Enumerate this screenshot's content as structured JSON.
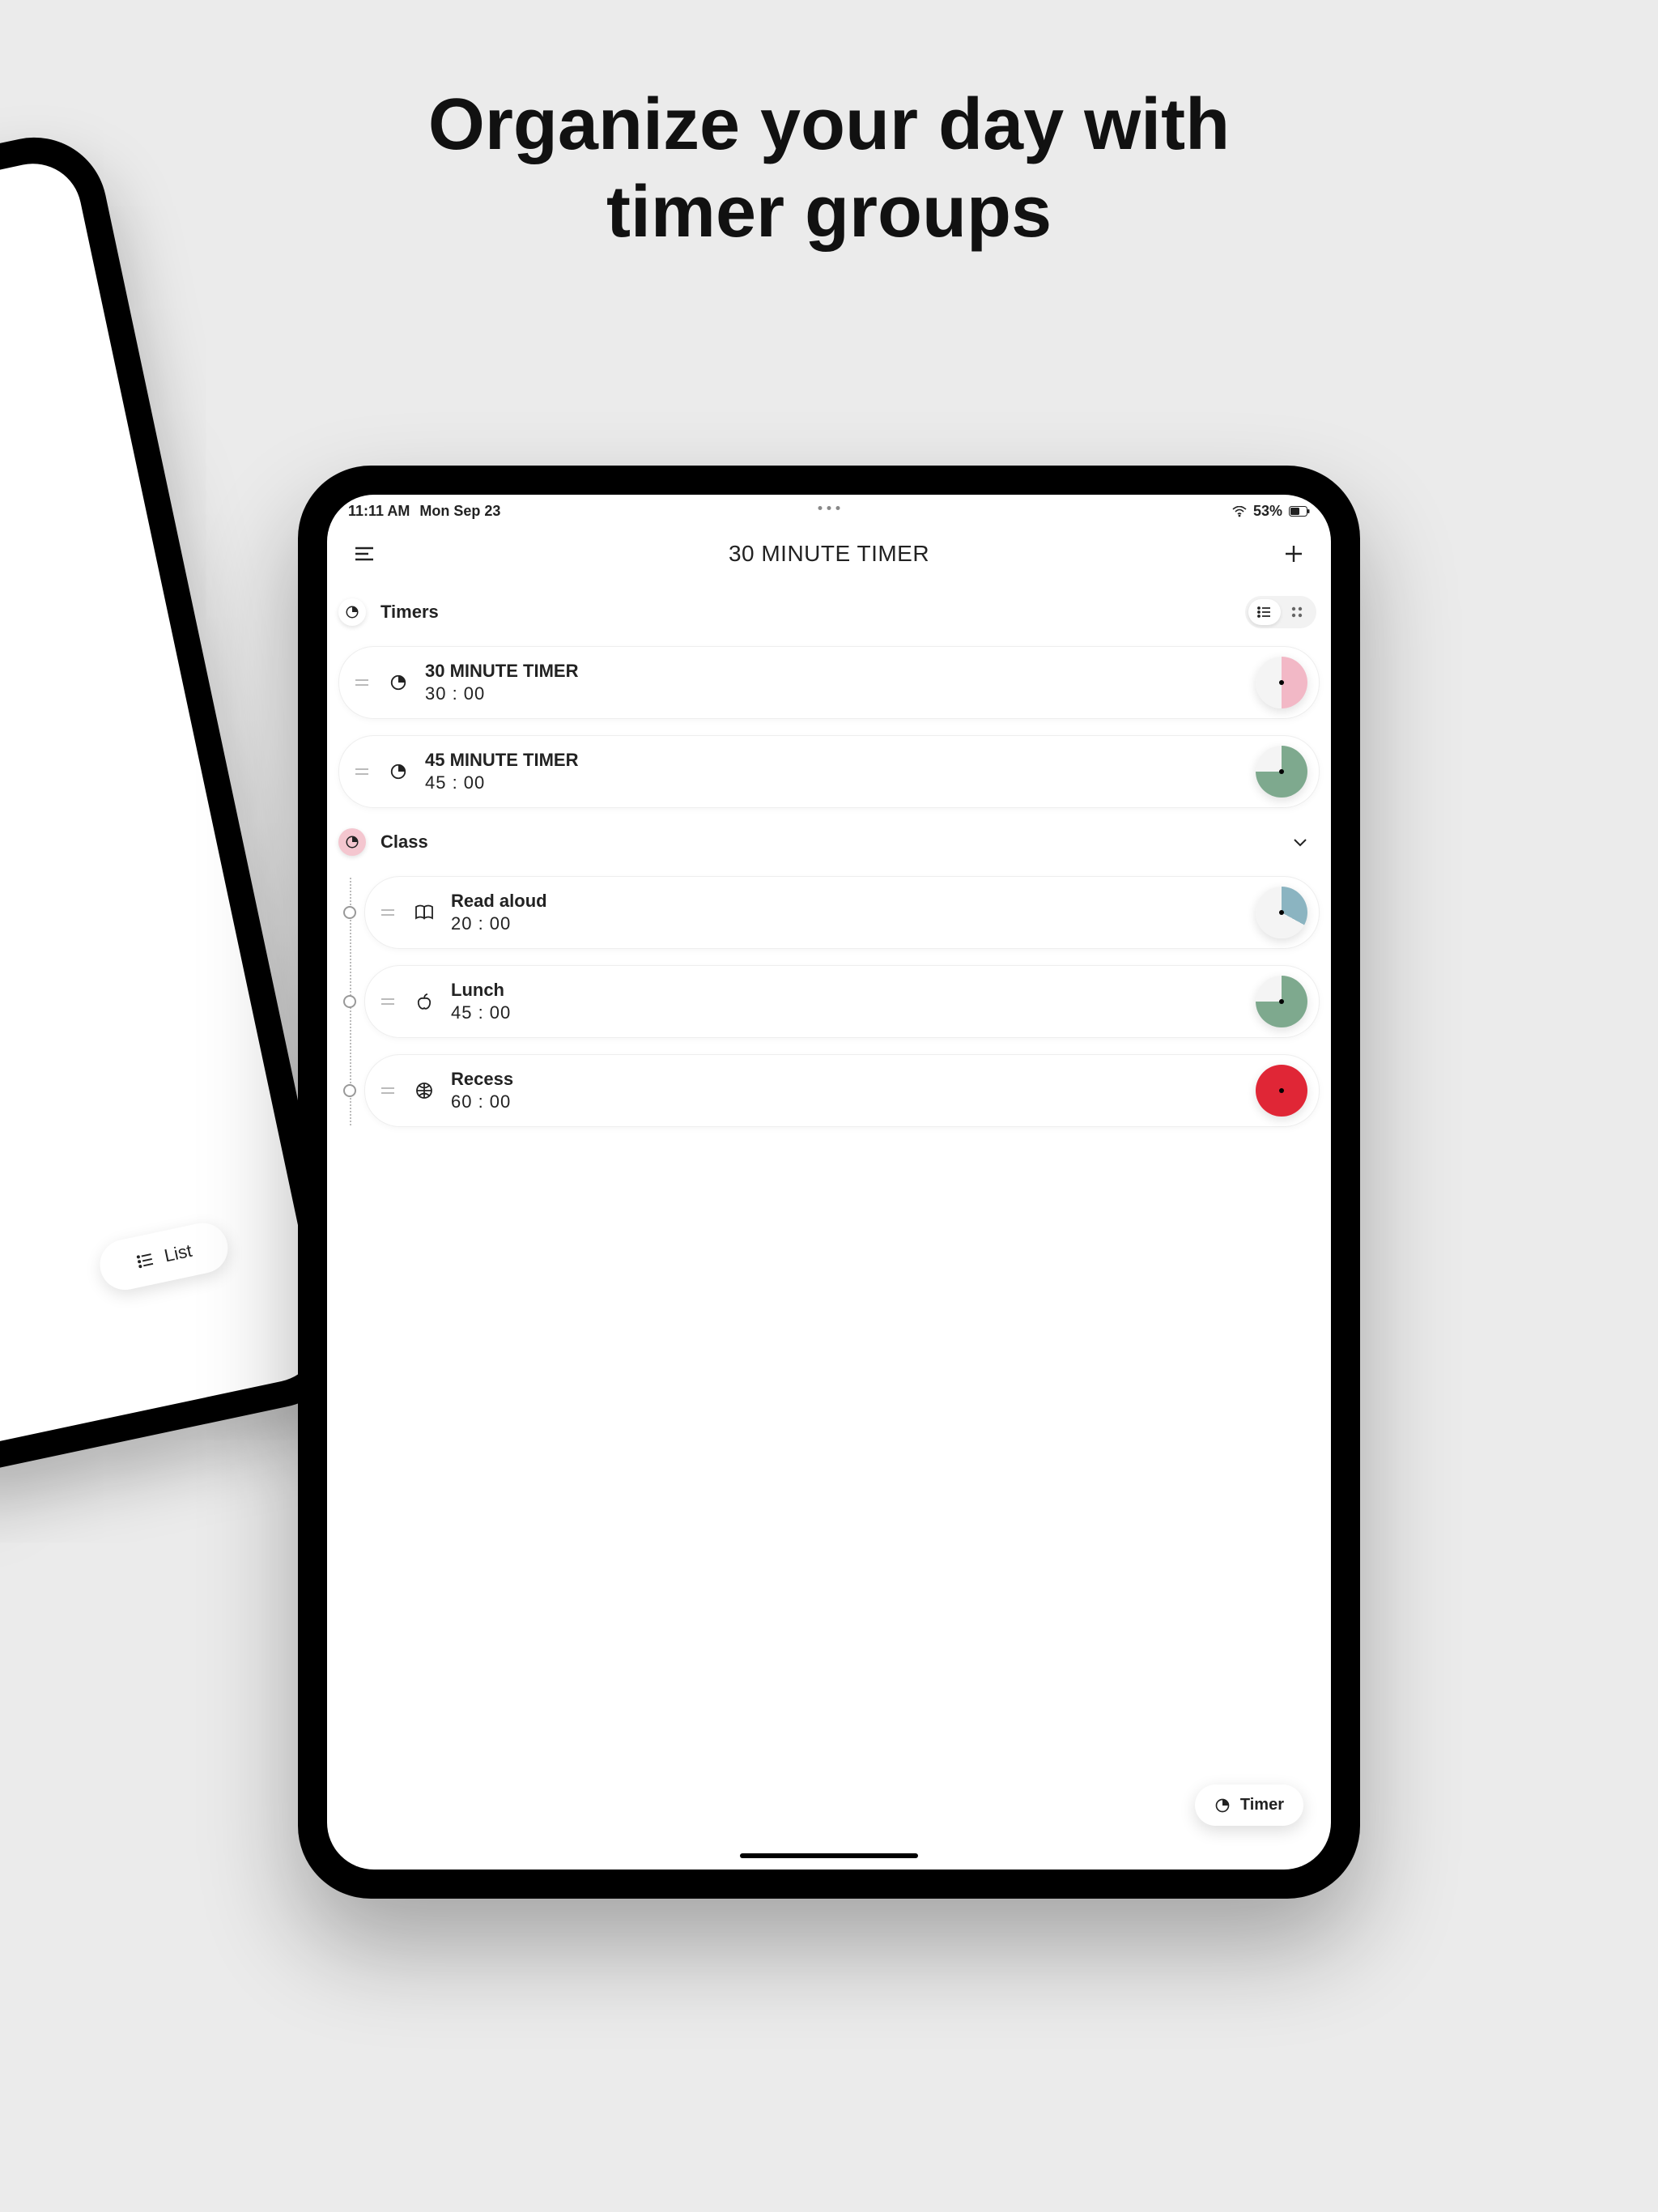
{
  "promo": {
    "line1": "Organize your day with",
    "line2": "timer groups"
  },
  "status_bar": {
    "time": "11:11 AM",
    "date": "Mon Sep 23",
    "battery": "53%"
  },
  "nav": {
    "title": "30 MINUTE TIMER"
  },
  "sections": {
    "timers": {
      "label": "Timers",
      "items": [
        {
          "name": "30 MINUTE TIMER",
          "time": "30 : 00",
          "icon": "clock",
          "disc_color": "#f2b8c6",
          "fraction": 0.5
        },
        {
          "name": "45 MINUTE TIMER",
          "time": "45 : 00",
          "icon": "clock",
          "disc_color": "#7ea98e",
          "fraction": 0.75
        }
      ]
    },
    "class": {
      "label": "Class",
      "items": [
        {
          "name": "Read aloud",
          "time": "20 : 00",
          "icon": "book",
          "disc_color": "#8bb4c1",
          "fraction": 0.33
        },
        {
          "name": "Lunch",
          "time": "45 : 00",
          "icon": "apple",
          "disc_color": "#7ea98e",
          "fraction": 0.75
        },
        {
          "name": "Recess",
          "time": "60 : 00",
          "icon": "ball",
          "disc_color": "#e02636",
          "fraction": 1
        }
      ]
    }
  },
  "float_button": {
    "label": "Timer"
  },
  "bg_tablet": {
    "list_label": "List"
  }
}
